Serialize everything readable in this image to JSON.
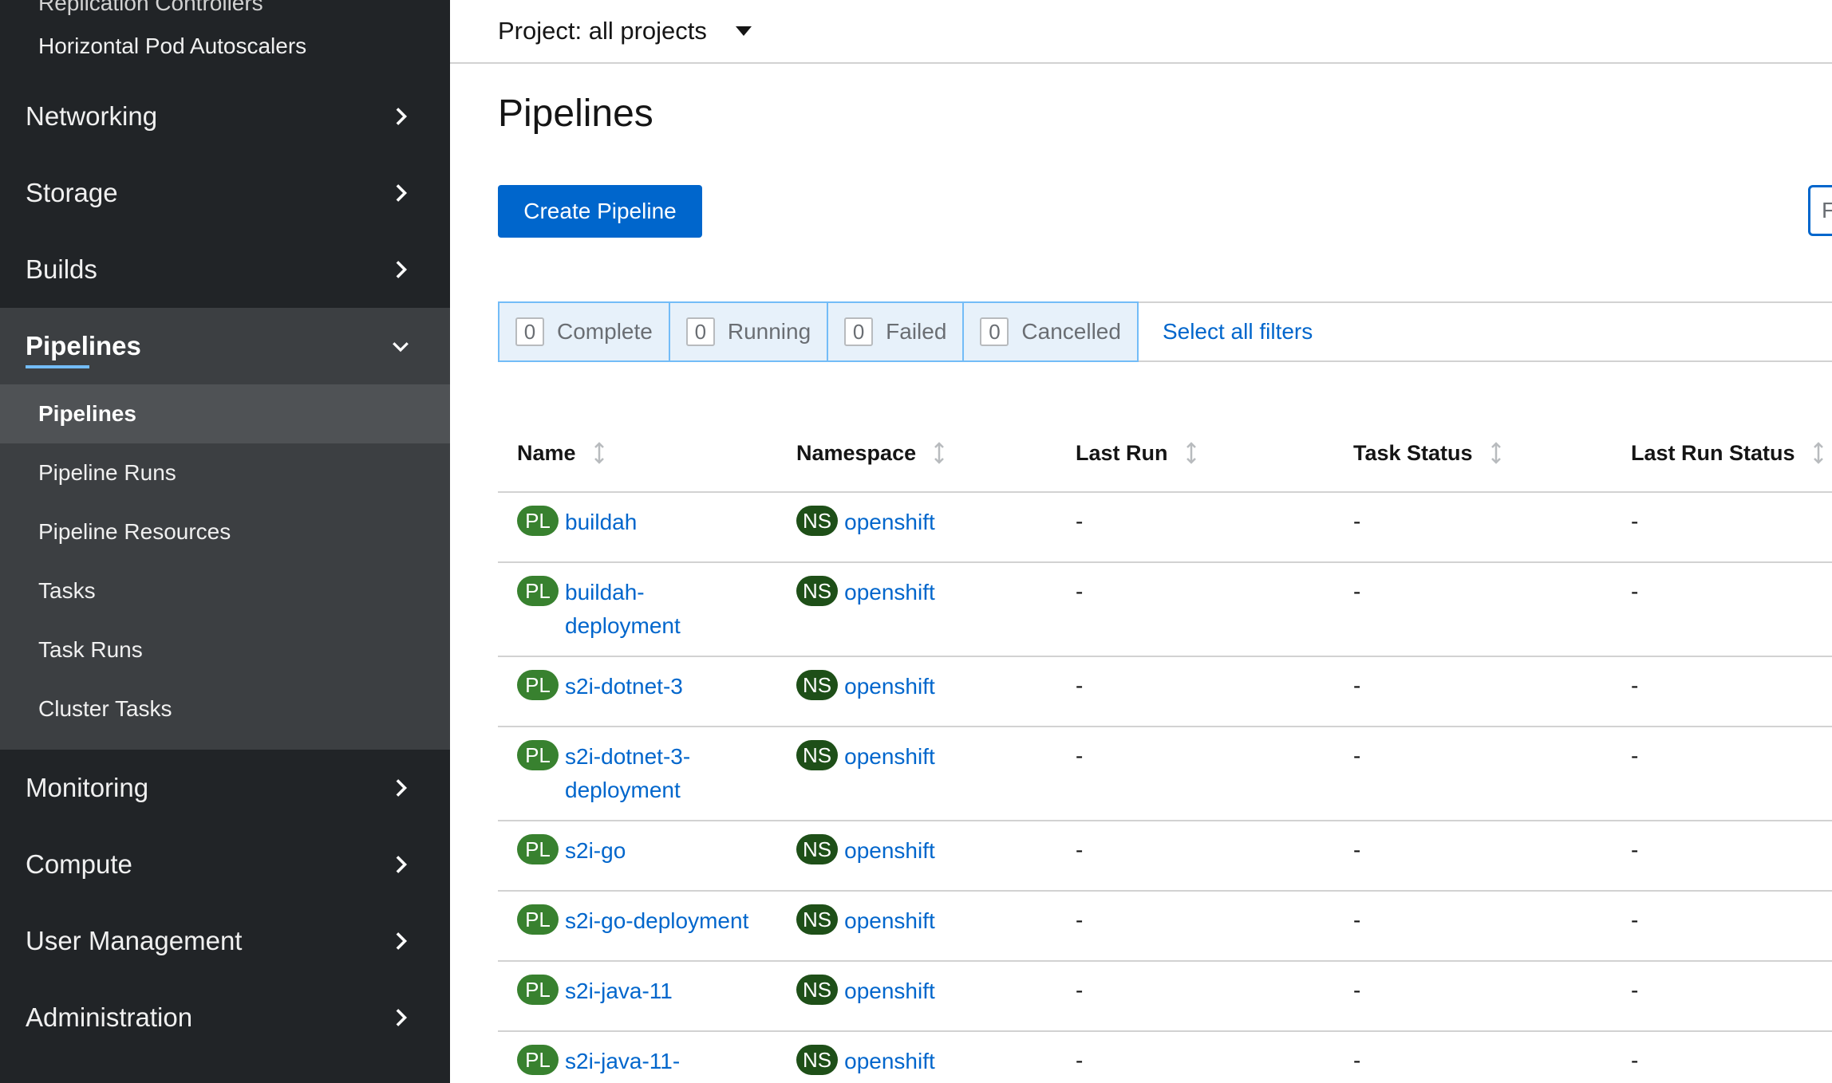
{
  "sidebar": {
    "top_items": [
      "Replication Controllers",
      "Horizontal Pod Autoscalers"
    ],
    "sections_before": [
      "Networking",
      "Storage",
      "Builds"
    ],
    "active_section": {
      "label": "Pipelines",
      "items": [
        "Pipelines",
        "Pipeline Runs",
        "Pipeline Resources",
        "Tasks",
        "Task Runs",
        "Cluster Tasks"
      ],
      "active_item": "Pipelines"
    },
    "sections_after": [
      "Monitoring",
      "Compute",
      "User Management",
      "Administration"
    ]
  },
  "project_selector": {
    "label": "Project: all projects"
  },
  "page": {
    "title": "Pipelines",
    "create_button": "Create Pipeline",
    "filter_placeholder": "F"
  },
  "status_filters": [
    {
      "count": "0",
      "label": "Complete"
    },
    {
      "count": "0",
      "label": "Running"
    },
    {
      "count": "0",
      "label": "Failed"
    },
    {
      "count": "0",
      "label": "Cancelled"
    }
  ],
  "select_all_filters": "Select all filters",
  "table": {
    "columns": [
      "Name",
      "Namespace",
      "Last Run",
      "Task Status",
      "Last Run Status"
    ],
    "name_badge": "PL",
    "namespace_badge": "NS",
    "rows": [
      {
        "name": "buildah",
        "namespace": "openshift",
        "last_run": "-",
        "task_status": "-",
        "last_run_status": "-"
      },
      {
        "name": "buildah-deployment",
        "namespace": "openshift",
        "last_run": "-",
        "task_status": "-",
        "last_run_status": "-"
      },
      {
        "name": "s2i-dotnet-3",
        "namespace": "openshift",
        "last_run": "-",
        "task_status": "-",
        "last_run_status": "-"
      },
      {
        "name": "s2i-dotnet-3-deployment",
        "namespace": "openshift",
        "last_run": "-",
        "task_status": "-",
        "last_run_status": "-"
      },
      {
        "name": "s2i-go",
        "namespace": "openshift",
        "last_run": "-",
        "task_status": "-",
        "last_run_status": "-"
      },
      {
        "name": "s2i-go-deployment",
        "namespace": "openshift",
        "last_run": "-",
        "task_status": "-",
        "last_run_status": "-"
      },
      {
        "name": "s2i-java-11",
        "namespace": "openshift",
        "last_run": "-",
        "task_status": "-",
        "last_run_status": "-"
      },
      {
        "name": "s2i-java-11-",
        "namespace": "openshift",
        "last_run": "-",
        "task_status": "-",
        "last_run_status": "-"
      }
    ]
  },
  "colors": {
    "sidebar_bg": "#212427",
    "accent": "#0066cc",
    "pl_badge": "#38812f",
    "ns_badge": "#1e4f18"
  }
}
